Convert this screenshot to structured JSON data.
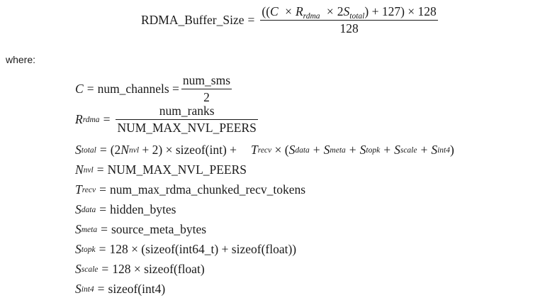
{
  "main_formula": {
    "lhs": "RDMA_Buffer_Size",
    "eq": "=",
    "num_a": "((",
    "C": "C",
    "times1": "×",
    "R": "R",
    "R_sub": "rdma",
    "times2": "×",
    "two": "2",
    "S": "S",
    "S_sub": "total",
    "num_b": ") + 127) × 128",
    "den": "128"
  },
  "where_label": "where:",
  "defs": {
    "c": {
      "sym": "C",
      "eq": "=",
      "rhs": "num_channels =",
      "num": "num_sms",
      "den": "2"
    },
    "r": {
      "sym": "R",
      "sub": "rdma",
      "eq": "=",
      "num": "num_ranks",
      "den": "NUM_MAX_NVL_PEERS"
    },
    "stotal": {
      "sym": "S",
      "sub": "total",
      "eq": "=",
      "part1": "(2",
      "n_sym": "N",
      "n_sub": "nvl",
      "part2": "+ 2) × sizeof(int) +",
      "t_sym": "T",
      "t_sub": "recv",
      "part3": "× (",
      "s1": "S",
      "s1_sub": "data",
      "plus1": "+",
      "s2": "S",
      "s2_sub": "meta",
      "plus2": "+",
      "s3": "S",
      "s3_sub": "topk",
      "plus3": "+",
      "s4": "S",
      "s4_sub": "scale",
      "plus4": "+",
      "s5": "S",
      "s5_sub": "int4",
      "close": ")"
    },
    "nnvl": {
      "sym": "N",
      "sub": "nvl",
      "eq": "=",
      "rhs": "NUM_MAX_NVL_PEERS"
    },
    "trecv": {
      "sym": "T",
      "sub": "recv",
      "eq": "=",
      "rhs": "num_max_rdma_chunked_recv_tokens"
    },
    "sdata": {
      "sym": "S",
      "sub": "data",
      "eq": "=",
      "rhs": "hidden_bytes"
    },
    "smeta": {
      "sym": "S",
      "sub": "meta",
      "eq": "=",
      "rhs": "source_meta_bytes"
    },
    "stopk": {
      "sym": "S",
      "sub": "topk",
      "eq": "=",
      "rhs": "128 × (sizeof(int64_t) + sizeof(float))"
    },
    "sscale": {
      "sym": "S",
      "sub": "scale",
      "eq": "=",
      "rhs": "128 × sizeof(float)"
    },
    "sint4": {
      "sym": "S",
      "sub": "int4",
      "eq": "=",
      "rhs": "sizeof(int4)"
    }
  }
}
